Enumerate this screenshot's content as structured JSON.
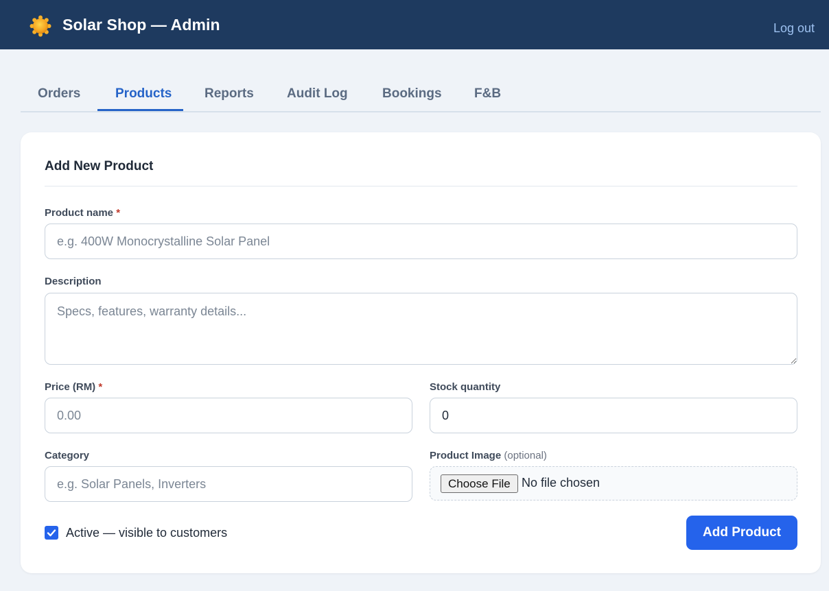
{
  "header": {
    "title": "Solar Shop — Admin",
    "logout_label": "Log out",
    "logo_icon": "sun-icon"
  },
  "tabs": [
    {
      "label": "Orders",
      "active": false
    },
    {
      "label": "Products",
      "active": true
    },
    {
      "label": "Reports",
      "active": false
    },
    {
      "label": "Audit Log",
      "active": false
    },
    {
      "label": "Bookings",
      "active": false
    },
    {
      "label": "F&B",
      "active": false
    }
  ],
  "form": {
    "title": "Add New Product",
    "required_marker": "*",
    "product_name": {
      "label": "Product name",
      "placeholder": "e.g. 400W Monocrystalline Solar Panel",
      "value": ""
    },
    "description": {
      "label": "Description",
      "placeholder": "Specs, features, warranty details...",
      "value": ""
    },
    "price": {
      "label": "Price (RM)",
      "placeholder": "0.00",
      "value": ""
    },
    "stock": {
      "label": "Stock quantity",
      "value": "0"
    },
    "category": {
      "label": "Category",
      "placeholder": "e.g. Solar Panels, Inverters",
      "value": ""
    },
    "image": {
      "label": "Product Image",
      "optional_note": "(optional)",
      "button_label": "Choose File",
      "status": "No file chosen"
    },
    "active": {
      "label": "Active — visible to customers",
      "checked": true
    },
    "submit_label": "Add Product"
  },
  "colors": {
    "header_bg": "#1e3a5f",
    "accent": "#2563eb",
    "active_tab": "#2563c8",
    "page_bg": "#eff3f8"
  }
}
